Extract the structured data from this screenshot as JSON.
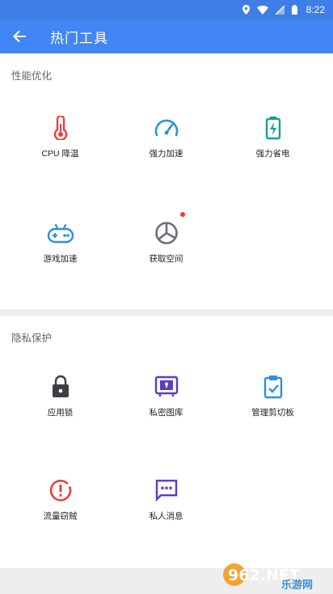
{
  "status": {
    "time": "8:22"
  },
  "appbar": {
    "title": "热门工具"
  },
  "sections": [
    {
      "title": "性能优化",
      "items": [
        {
          "label": "CPU 降温",
          "icon": "thermometer-icon"
        },
        {
          "label": "强力加速",
          "icon": "speedometer-icon"
        },
        {
          "label": "强力省电",
          "icon": "battery-icon"
        },
        {
          "label": "游戏加速",
          "icon": "gamepad-icon"
        },
        {
          "label": "获取空间",
          "icon": "pie-chart-icon",
          "badge": true
        }
      ]
    },
    {
      "title": "隐私保护",
      "items": [
        {
          "label": "应用锁",
          "icon": "lock-icon"
        },
        {
          "label": "私密图库",
          "icon": "private-gallery-icon"
        },
        {
          "label": "管理剪切板",
          "icon": "clipboard-icon"
        },
        {
          "label": "流量窃贼",
          "icon": "alert-icon"
        },
        {
          "label": "私人消息",
          "icon": "message-icon"
        }
      ]
    }
  ],
  "watermark": {
    "brand": "962.NET",
    "text": "乐游网"
  },
  "colors": {
    "status_bar": "#3f7ee6",
    "app_bar": "#4285f4",
    "red": "#e8413c",
    "blue": "#2f8fe0",
    "teal": "#1aa08a",
    "gray": "#6e6e76",
    "purple": "#5b3fc4",
    "dark": "#3e3e44"
  }
}
